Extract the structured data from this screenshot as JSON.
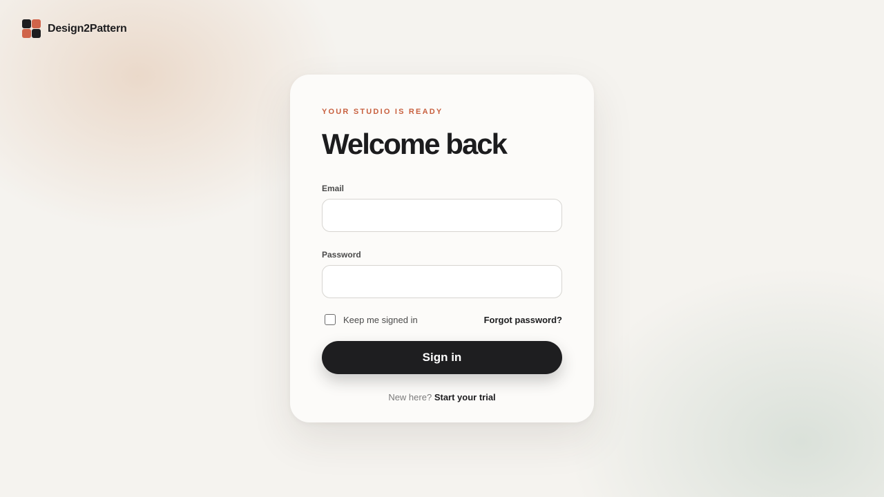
{
  "brand": {
    "name": "Design2Pattern",
    "logo_colors": [
      "#1e1e20",
      "#d0644a",
      "#d0644a",
      "#1e1e20"
    ]
  },
  "login": {
    "eyebrow": "YOUR STUDIO IS READY",
    "title": "Welcome back",
    "email_label": "Email",
    "email_value": "",
    "email_placeholder": "",
    "password_label": "Password",
    "password_value": "",
    "password_placeholder": "",
    "remember_label": "Keep me signed in",
    "remember_checked": false,
    "forgot_label": "Forgot password?",
    "submit_label": "Sign in",
    "signup_prompt": "New here?",
    "signup_link": "Start your trial"
  },
  "colors": {
    "accent": "#c8603f",
    "primary_button": "#1e1e20",
    "background": "#f5f3ef",
    "card": "#fcfbf9"
  }
}
